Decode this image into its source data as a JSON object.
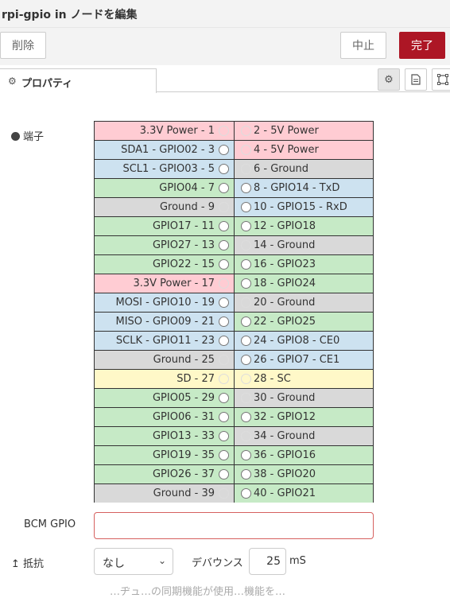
{
  "header": {
    "title": "rpi-gpio in ノードを編集"
  },
  "toolbar": {
    "delete_label": "削除",
    "cancel_label": "中止",
    "done_label": "完了",
    "done_color": "#ad1625"
  },
  "tabs": {
    "properties_label": "プロパティ",
    "gear_icon": "gear-icon"
  },
  "tab_buttons": [
    "gear-icon",
    "document-icon",
    "frame-icon"
  ],
  "form": {
    "pins_label": "端子",
    "bcm_label": "BCM GPIO",
    "bcm_value": "",
    "resistor_label": "抵抗",
    "resistor_value": "なし",
    "debounce_label": "デバウンス",
    "debounce_value": "25",
    "debounce_unit": "mS",
    "cut_text": "…ヂュ…の同期機能が使用…機能を…"
  },
  "colors": {
    "power": "#ffccd3",
    "ground": "#d9d9d9",
    "gpio": "#c6eac6",
    "special": "#cde2f0",
    "sd": "#fff8c8"
  },
  "pins": [
    {
      "left": "3.3V Power - 1",
      "left_type": "power",
      "left_enabled": false,
      "right": "2 - 5V Power",
      "right_type": "power",
      "right_enabled": false
    },
    {
      "left": "SDA1 - GPIO02 - 3",
      "left_type": "special",
      "left_enabled": true,
      "right": "4 - 5V Power",
      "right_type": "power",
      "right_enabled": false
    },
    {
      "left": "SCL1 - GPIO03 - 5",
      "left_type": "special",
      "left_enabled": true,
      "right": "6 - Ground",
      "right_type": "ground",
      "right_enabled": false
    },
    {
      "left": "GPIO04 - 7",
      "left_type": "gpio",
      "left_enabled": true,
      "right": "8 - GPIO14 - TxD",
      "right_type": "special",
      "right_enabled": true
    },
    {
      "left": "Ground - 9",
      "left_type": "ground",
      "left_enabled": false,
      "right": "10 - GPIO15 - RxD",
      "right_type": "special",
      "right_enabled": true
    },
    {
      "left": "GPIO17 - 11",
      "left_type": "gpio",
      "left_enabled": true,
      "right": "12 - GPIO18",
      "right_type": "gpio",
      "right_enabled": true
    },
    {
      "left": "GPIO27 - 13",
      "left_type": "gpio",
      "left_enabled": true,
      "right": "14 - Ground",
      "right_type": "ground",
      "right_enabled": false
    },
    {
      "left": "GPIO22 - 15",
      "left_type": "gpio",
      "left_enabled": true,
      "right": "16 - GPIO23",
      "right_type": "gpio",
      "right_enabled": true
    },
    {
      "left": "3.3V Power - 17",
      "left_type": "power",
      "left_enabled": false,
      "right": "18 - GPIO24",
      "right_type": "gpio",
      "right_enabled": true
    },
    {
      "left": "MOSI - GPIO10 - 19",
      "left_type": "special",
      "left_enabled": true,
      "right": "20 - Ground",
      "right_type": "ground",
      "right_enabled": false
    },
    {
      "left": "MISO - GPIO09 - 21",
      "left_type": "special",
      "left_enabled": true,
      "right": "22 - GPIO25",
      "right_type": "gpio",
      "right_enabled": true
    },
    {
      "left": "SCLK - GPIO11 - 23",
      "left_type": "special",
      "left_enabled": true,
      "right": "24 - GPIO8 - CE0",
      "right_type": "special",
      "right_enabled": true
    },
    {
      "left": "Ground - 25",
      "left_type": "ground",
      "left_enabled": false,
      "right": "26 - GPIO7 - CE1",
      "right_type": "special",
      "right_enabled": true
    },
    {
      "left": "SD - 27",
      "left_type": "sd",
      "left_enabled": false,
      "right": "28 - SC",
      "right_type": "sd",
      "right_enabled": false
    },
    {
      "left": "GPIO05 - 29",
      "left_type": "gpio",
      "left_enabled": true,
      "right": "30 - Ground",
      "right_type": "ground",
      "right_enabled": false
    },
    {
      "left": "GPIO06 - 31",
      "left_type": "gpio",
      "left_enabled": true,
      "right": "32 - GPIO12",
      "right_type": "gpio",
      "right_enabled": true
    },
    {
      "left": "GPIO13 - 33",
      "left_type": "gpio",
      "left_enabled": true,
      "right": "34 - Ground",
      "right_type": "ground",
      "right_enabled": false
    },
    {
      "left": "GPIO19 - 35",
      "left_type": "gpio",
      "left_enabled": true,
      "right": "36 - GPIO16",
      "right_type": "gpio",
      "right_enabled": true
    },
    {
      "left": "GPIO26 - 37",
      "left_type": "gpio",
      "left_enabled": true,
      "right": "38 - GPIO20",
      "right_type": "gpio",
      "right_enabled": true
    },
    {
      "left": "Ground - 39",
      "left_type": "ground",
      "left_enabled": false,
      "right": "40 - GPIO21",
      "right_type": "gpio",
      "right_enabled": true
    }
  ]
}
